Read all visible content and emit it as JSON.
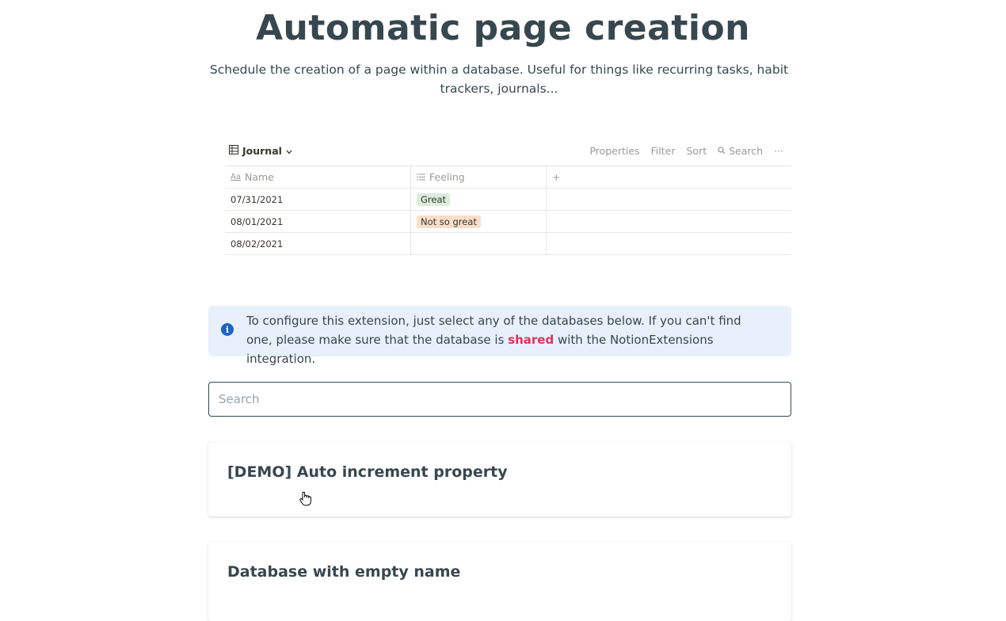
{
  "page": {
    "title": "Automatic page creation",
    "subtitle": "Schedule the creation of a page within a database. Useful for things like recurring tasks, habit trackers, journals..."
  },
  "preview": {
    "db_title": "Journal",
    "actions": {
      "properties": "Properties",
      "filter": "Filter",
      "sort": "Sort",
      "search": "Search",
      "more": "···"
    },
    "columns": {
      "name": "Name",
      "feeling": "Feeling",
      "add": "+"
    },
    "rows": [
      {
        "name": "07/31/2021",
        "feeling": "Great",
        "color": "#dbeddb"
      },
      {
        "name": "08/01/2021",
        "feeling": "Not so great",
        "color": "#fadec9"
      },
      {
        "name": "08/02/2021",
        "feeling": ""
      }
    ]
  },
  "callout": {
    "text_before": "To configure this extension, just select any of the databases below. If you can't find one, please make sure that the database is ",
    "highlight": "shared",
    "text_after": " with the NotionExtensions integration."
  },
  "search": {
    "placeholder": "Search",
    "value": ""
  },
  "databases": [
    {
      "title": "[DEMO] Auto increment property"
    },
    {
      "title": "Database with empty name"
    }
  ],
  "colors": {
    "text": "#37474f",
    "callout_bg": "#e8f0fb",
    "info_icon": "#1e63c4",
    "highlight": "#e0335c"
  }
}
